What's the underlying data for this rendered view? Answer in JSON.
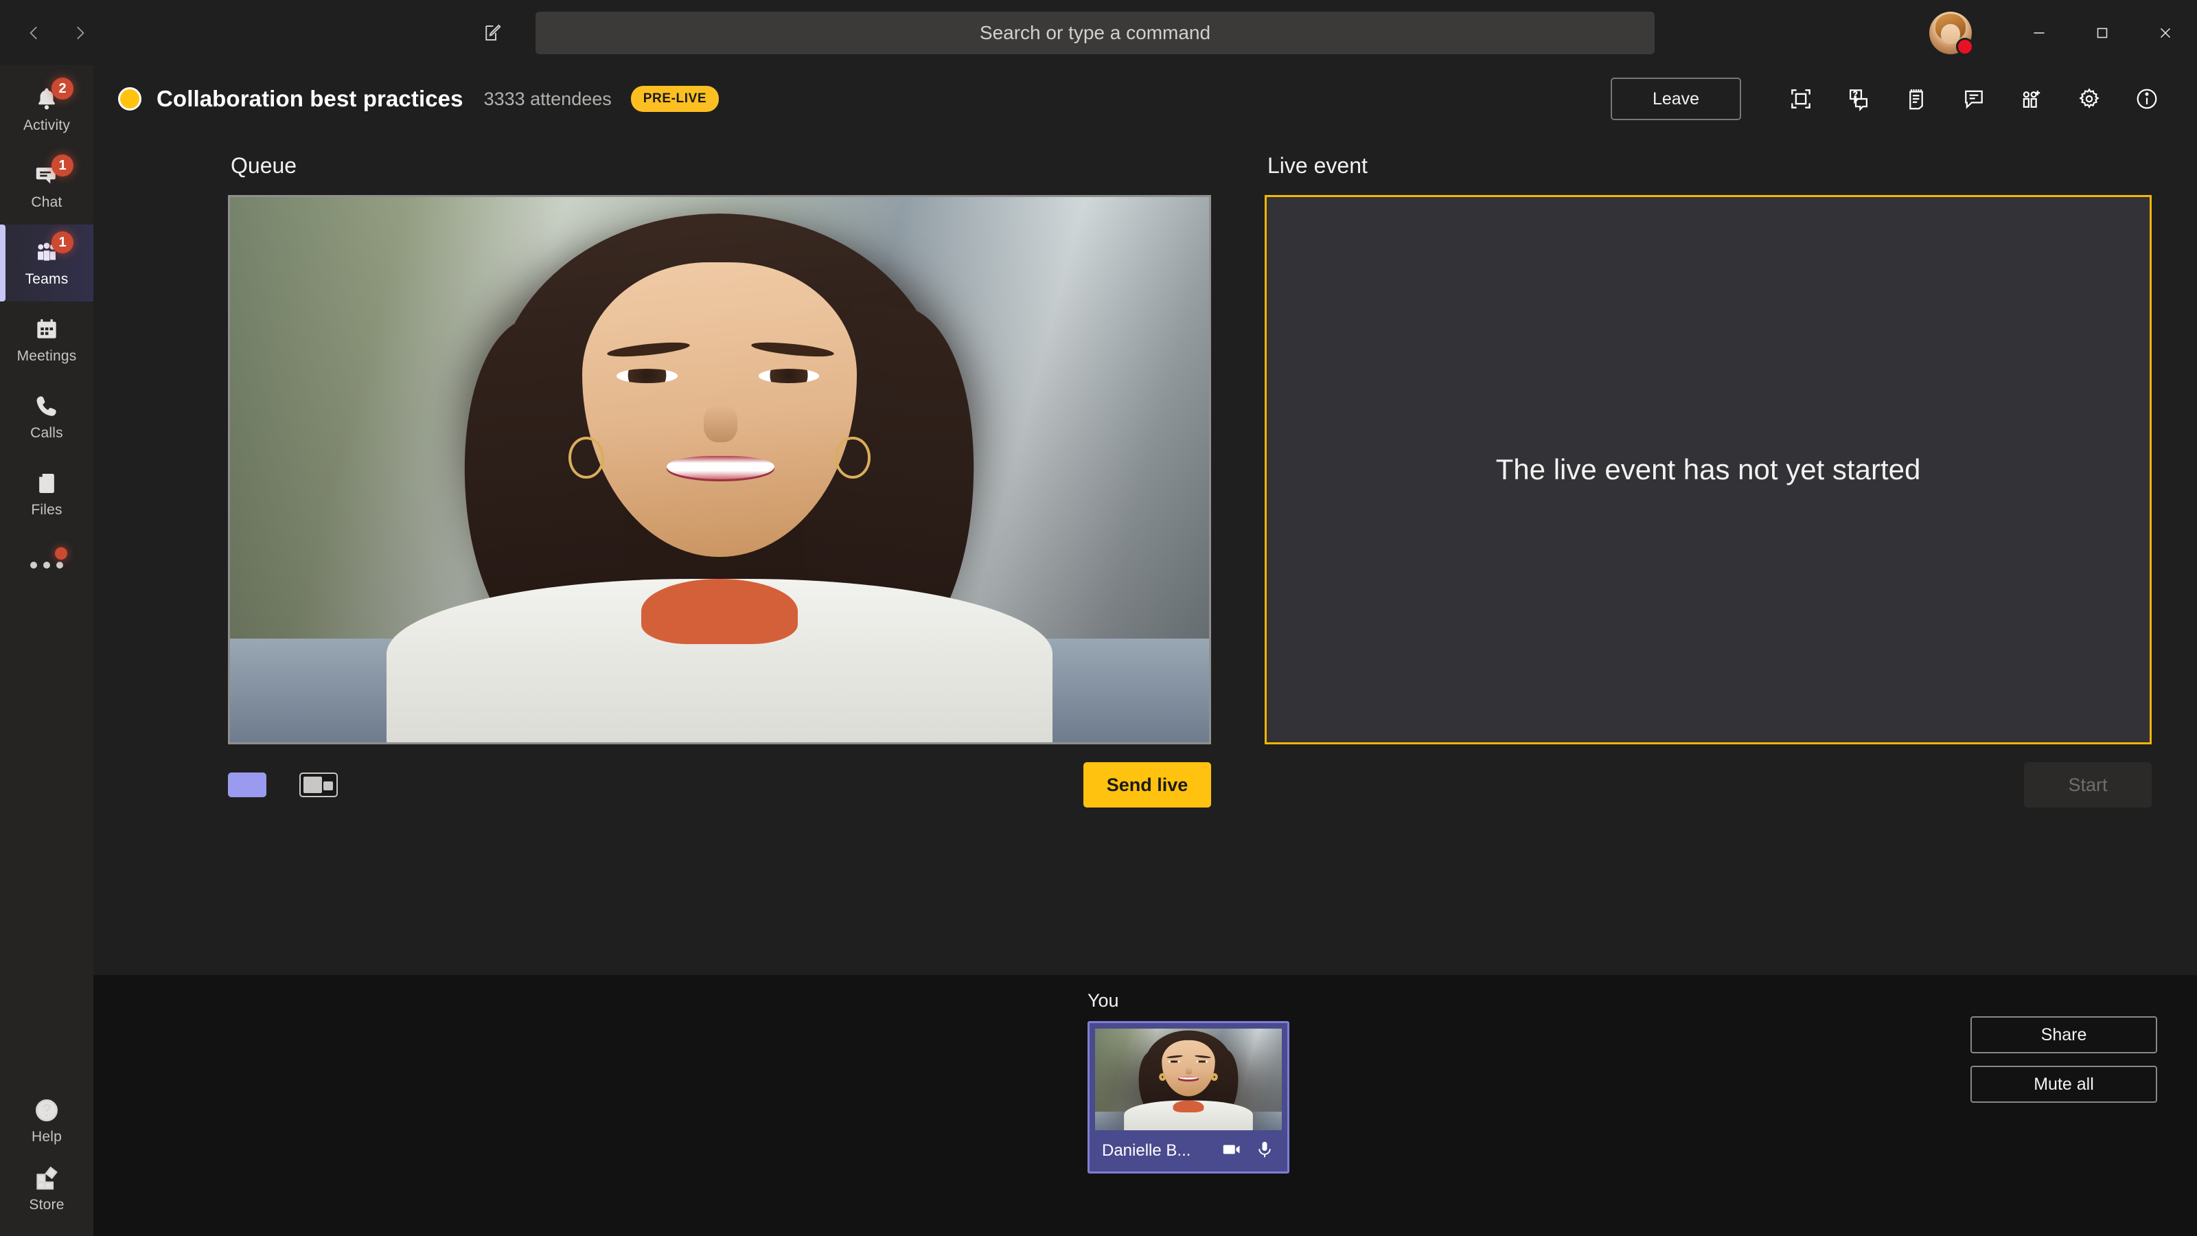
{
  "titlebar": {
    "back_icon": "chevron-left-icon",
    "forward_icon": "chevron-right-icon",
    "compose_icon": "compose-icon",
    "search_placeholder": "Search or type a command",
    "minimize_label": "Minimize",
    "maximize_label": "Maximize",
    "close_label": "Close",
    "avatar_status": "busy",
    "status_color": "#e81123"
  },
  "sidebar": {
    "items": [
      {
        "label": "Activity",
        "icon": "bell-icon",
        "badge": "2",
        "selected": false
      },
      {
        "label": "Chat",
        "icon": "chat-icon",
        "badge": "1",
        "selected": false
      },
      {
        "label": "Teams",
        "icon": "teams-icon",
        "badge": "1",
        "selected": true
      },
      {
        "label": "Meetings",
        "icon": "calendar-icon",
        "badge": "",
        "selected": false
      },
      {
        "label": "Calls",
        "icon": "phone-icon",
        "badge": "",
        "selected": false
      },
      {
        "label": "Files",
        "icon": "file-icon",
        "badge": "",
        "selected": false
      }
    ],
    "more_icon": "ellipsis-icon",
    "bottom": [
      {
        "label": "Help",
        "icon": "help-icon"
      },
      {
        "label": "Store",
        "icon": "store-icon"
      }
    ]
  },
  "meeting": {
    "status_icon": "live-event-status-icon",
    "status_color": "#ffc20e",
    "title": "Collaboration best practices",
    "attendees": "3333 attendees",
    "state_badge": "PRE-LIVE",
    "leave_label": "Leave",
    "toolbar_icons": [
      "fullscreen-icon",
      "qna-icon",
      "notes-icon",
      "chat-icon",
      "add-participant-icon",
      "settings-gear-icon",
      "info-icon"
    ]
  },
  "queue": {
    "title": "Queue",
    "layout_single_icon": "layout-single-icon",
    "layout_split_icon": "layout-split-icon",
    "send_live_label": "Send live"
  },
  "live": {
    "title": "Live event",
    "message": "The live event has not yet started",
    "start_label": "Start",
    "border_color": "#f2b705"
  },
  "footer": {
    "you_label": "You",
    "participant_name": "Danielle B...",
    "camera_icon": "camera-icon",
    "mic_icon": "microphone-icon",
    "share_label": "Share",
    "mute_all_label": "Mute all"
  }
}
